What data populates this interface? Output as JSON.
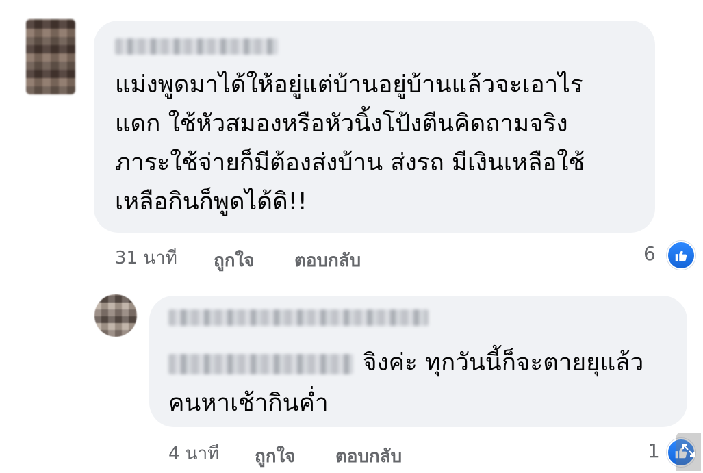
{
  "comment_main": {
    "author_name": "Tom Teerapong",
    "text_lines": [
      "แม่งพูดมาได้ให้อยู่แต่บ้านอยู่บ้านแล้วจะเอาไร",
      "แดก  ใช้หัวสมองหรือหัวนิ้งโป้งตีนคิดถามจริง",
      "ภาระใช้จ่ายก็มีต้องส่งบ้าน ส่งรถ มีเงินเหลือใช้",
      "เหลือกินก็พูดได้ดิ!!"
    ],
    "time": "31 นาที",
    "like_label": "ถูกใจ",
    "reply_label": "ตอบกลับ",
    "reaction_count": "6",
    "reaction_icon": "like-icon"
  },
  "comment_reply": {
    "author_name": "ศิริพร ศิลปินทองคำ",
    "tagged_name": "Tom Teerapong",
    "text_line1": "จิงค่ะ ทุกวันนี้ก็จะตายยุแล้ว",
    "text_line2": "คนหาเช้ากินค่ำ",
    "time": "4 นาที",
    "like_label": "ถูกใจ",
    "reply_label": "ตอบกลับ",
    "reaction_count": "1",
    "reaction_icon": "like-icon"
  },
  "colors": {
    "bubble_bg": "#f0f2f5",
    "text": "#050505",
    "meta_text": "#65676b",
    "like_blue": "#1877f2"
  }
}
